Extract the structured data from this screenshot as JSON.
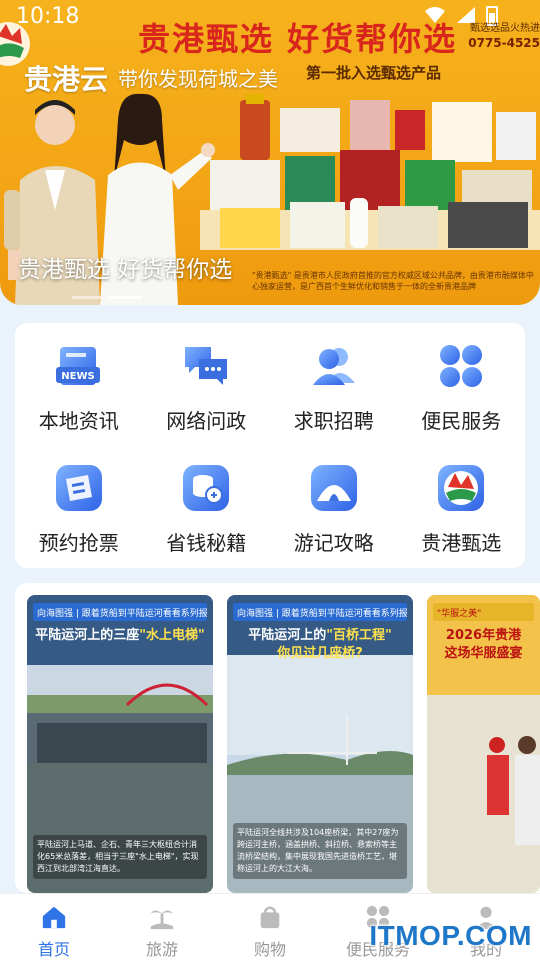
{
  "status_bar": {
    "time": "10:18"
  },
  "banner": {
    "app_title": "贵港云",
    "app_slogan": "带你发现荷城之美",
    "ad_headline": "贵港甄选  好货帮你选",
    "ad_side_line1": "甄选选品火热进",
    "ad_side_phone": "0775-4525",
    "ad_sub": "第一批入选甄选产品",
    "caption": "贵港甄选  好货帮你选",
    "fine_print": "\"贵港甄选\" 是贵港市人民政府首推的官方权威区域公共品牌，由贵港市融媒体中心独家运营，是广西首个生鲜优化和销售于一体的全新贵港品牌"
  },
  "grid": {
    "items": [
      {
        "label": "本地资讯",
        "icon": "news-icon"
      },
      {
        "label": "网络问政",
        "icon": "chat-icon"
      },
      {
        "label": "求职招聘",
        "icon": "people-icon"
      },
      {
        "label": "便民服务",
        "icon": "four-petal-icon"
      },
      {
        "label": "预约抢票",
        "icon": "ticket-icon"
      },
      {
        "label": "省钱秘籍",
        "icon": "coins-icon"
      },
      {
        "label": "游记攻略",
        "icon": "tent-icon"
      },
      {
        "label": "贵港甄选",
        "icon": "brand-logo-icon"
      }
    ]
  },
  "feed": {
    "videos": [
      {
        "tag": "向海图强 | 跟着货船到平陆运河看看系列报道",
        "title_pre": "平陆运河上的三座",
        "title_hl": "\"水上电梯\"",
        "body": "平陆运河上马道、企石、青年三大枢纽合计消化65米总落差，相当于三座\"水上电梯\"，实现西江到北部湾江海直达。"
      },
      {
        "tag": "向海图强 | 跟着货船到平陆运河看看系列报道",
        "title_pre": "平陆运河上的",
        "title_hl": "\"百桥工程\"",
        "title_post": "你见过几座桥?",
        "body": "平陆运河全线共涉及104座桥梁，其中27座为跨运河主桥，涵盖拱桥、斜拉桥、悬索桥等主流桥梁结构，集中展现我国先进造桥工艺，堪称运河上的大江大海。"
      },
      {
        "tag": "\"华服之美\"",
        "title_pre": "2026年贵港",
        "title_hl": "",
        "title_post": "这场华服盛宴",
        "body": ""
      }
    ]
  },
  "tabbar": {
    "tabs": [
      {
        "label": "首页",
        "icon": "home-icon",
        "active": true
      },
      {
        "label": "旅游",
        "icon": "island-icon",
        "active": false
      },
      {
        "label": "购物",
        "icon": "bag-icon",
        "active": false
      },
      {
        "label": "便民服务",
        "icon": "four-petal-icon",
        "active": false
      },
      {
        "label": "我的",
        "icon": "user-icon",
        "active": false
      }
    ]
  },
  "watermark": "ITMOP.COM",
  "colors": {
    "accent": "#2f74e6",
    "banner": "#f3a515",
    "headline": "#d9261c"
  }
}
